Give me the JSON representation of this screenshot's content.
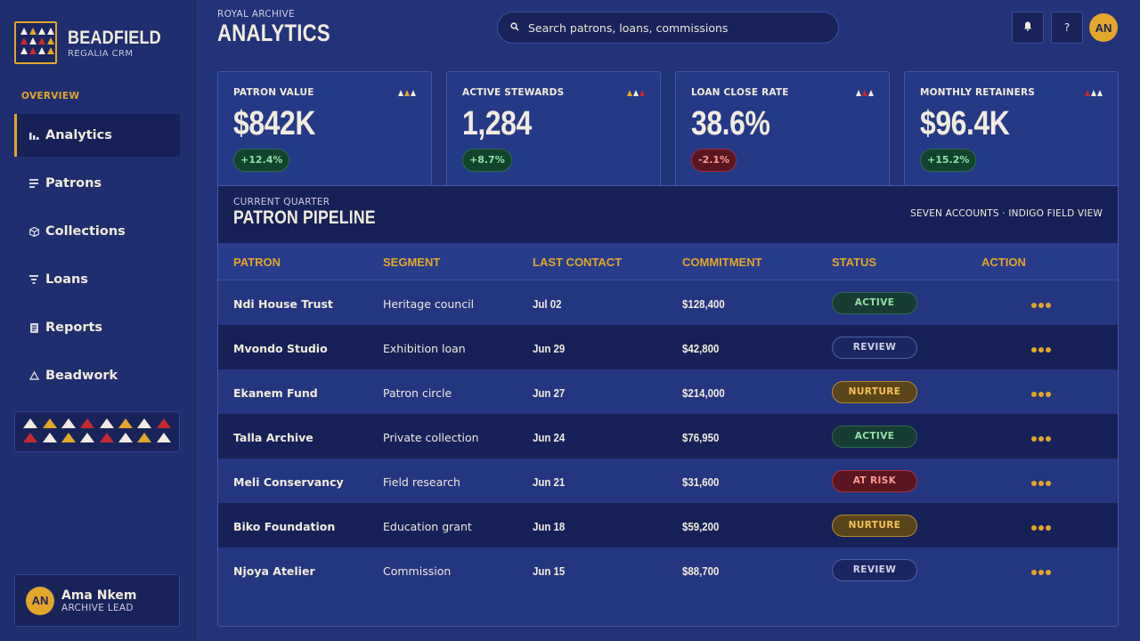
{
  "brand": {
    "name": "BEADFIELD",
    "sub": "REGALIA CRM"
  },
  "sidebar": {
    "section": "OVERVIEW",
    "items": [
      {
        "label": "Analytics",
        "icon": "bar-chart-icon",
        "active": true
      },
      {
        "label": "Patrons",
        "icon": "list-icon"
      },
      {
        "label": "Collections",
        "icon": "box-icon"
      },
      {
        "label": "Loans",
        "icon": "filter-icon"
      },
      {
        "label": "Reports",
        "icon": "document-icon"
      },
      {
        "label": "Beadwork",
        "icon": "triangle-icon"
      }
    ]
  },
  "user": {
    "initials": "AN",
    "name": "Ama Nkem",
    "role": "ARCHIVE LEAD"
  },
  "header": {
    "eyebrow": "ROYAL ARCHIVE",
    "title": "ANALYTICS"
  },
  "search": {
    "placeholder": "Search patrons, loans, commissions"
  },
  "topbar": {
    "notifications_icon": "bell-icon",
    "help_label": "?",
    "avatar_initials": "AN"
  },
  "kpis": [
    {
      "label": "PATRON VALUE",
      "value": "$842K",
      "delta": "+12.4%",
      "trend": "up"
    },
    {
      "label": "ACTIVE STEWARDS",
      "value": "1,284",
      "delta": "+8.7%",
      "trend": "up"
    },
    {
      "label": "LOAN CLOSE RATE",
      "value": "38.6%",
      "delta": "-2.1%",
      "trend": "down"
    },
    {
      "label": "MONTHLY RETAINERS",
      "value": "$96.4K",
      "delta": "+15.2%",
      "trend": "up"
    }
  ],
  "pipeline": {
    "eyebrow": "CURRENT QUARTER",
    "title": "PATRON PIPELINE",
    "note": "SEVEN ACCOUNTS · INDIGO FIELD VIEW",
    "columns": [
      "PATRON",
      "SEGMENT",
      "LAST CONTACT",
      "COMMITMENT",
      "STATUS",
      "ACTION"
    ],
    "rows": [
      {
        "patron": "Ndi House Trust",
        "segment": "Heritage council",
        "contact": "Jul 02",
        "commitment": "$128,400",
        "status": "ACTIVE",
        "kind": "active"
      },
      {
        "patron": "Mvondo Studio",
        "segment": "Exhibition loan",
        "contact": "Jun 29",
        "commitment": "$42,800",
        "status": "REVIEW",
        "kind": "review"
      },
      {
        "patron": "Ekanem Fund",
        "segment": "Patron circle",
        "contact": "Jun 27",
        "commitment": "$214,000",
        "status": "NURTURE",
        "kind": "nurture"
      },
      {
        "patron": "Talla Archive",
        "segment": "Private collection",
        "contact": "Jun 24",
        "commitment": "$76,950",
        "status": "ACTIVE",
        "kind": "active"
      },
      {
        "patron": "Meli Conservancy",
        "segment": "Field research",
        "contact": "Jun 21",
        "commitment": "$31,600",
        "status": "AT RISK",
        "kind": "risk"
      },
      {
        "patron": "Biko Foundation",
        "segment": "Education grant",
        "contact": "Jun 18",
        "commitment": "$59,200",
        "status": "NURTURE",
        "kind": "nurture"
      },
      {
        "patron": "Njoya Atelier",
        "segment": "Commission",
        "contact": "Jun 15",
        "commitment": "$88,700",
        "status": "REVIEW",
        "kind": "review"
      }
    ]
  },
  "colors": {
    "gold": "#e3a62b",
    "red": "#c9282f",
    "indigo": "#22337a",
    "ink": "#f1ecdf"
  }
}
